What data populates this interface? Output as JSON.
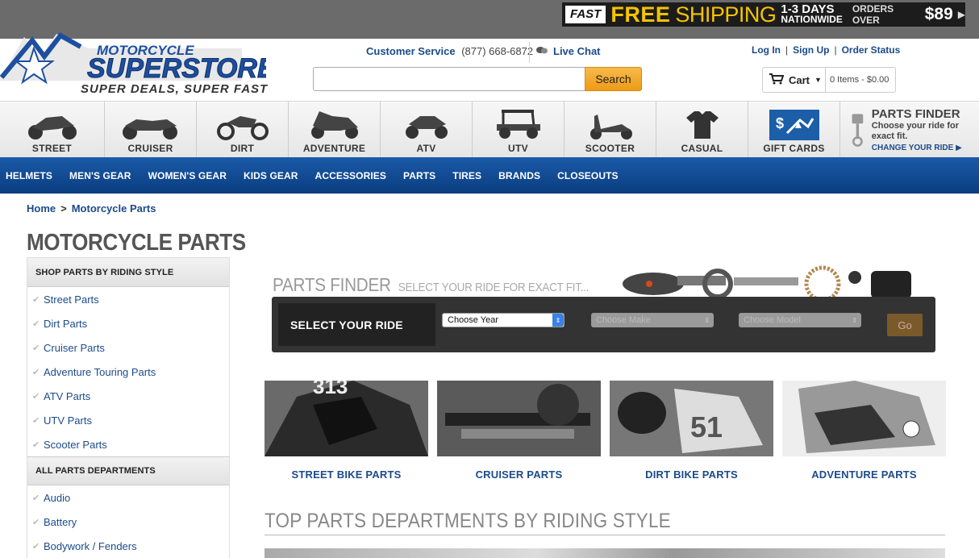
{
  "promo": {
    "fast": "FAST",
    "free": "FREE",
    "shipping": "SHIPPING",
    "days": "1-3 DAYS",
    "nationwide": "NATIONWIDE",
    "orders_over": "ORDERS OVER",
    "amount": "$89"
  },
  "header": {
    "logo_text": "MOTORCYCLE SUPERSTORE",
    "tagline": "SUPER DEALS, SUPER FAST",
    "customer_service_label": "Customer Service",
    "customer_service_phone": "(877) 668-6872",
    "live_chat": "Live Chat",
    "login": "Log In",
    "signup": "Sign Up",
    "order_status": "Order Status",
    "search_button": "Search",
    "cart_label": "Cart",
    "cart_items": "0 Items - $0.00"
  },
  "categories": [
    {
      "label": "STREET"
    },
    {
      "label": "CRUISER"
    },
    {
      "label": "DIRT"
    },
    {
      "label": "ADVENTURE"
    },
    {
      "label": "ATV"
    },
    {
      "label": "UTV"
    },
    {
      "label": "SCOOTER"
    },
    {
      "label": "CASUAL"
    },
    {
      "label": "GIFT CARDS"
    }
  ],
  "parts_finder_box": {
    "title": "PARTS FINDER",
    "subtitle": "Choose your ride for exact fit.",
    "link": "CHANGE YOUR RIDE ▶"
  },
  "nav": [
    "HELMETS",
    "MEN'S GEAR",
    "WOMEN'S GEAR",
    "KIDS GEAR",
    "ACCESSORIES",
    "PARTS",
    "TIRES",
    "BRANDS",
    "CLOSEOUTS"
  ],
  "breadcrumb": {
    "home": "Home",
    "current": "Motorcycle Parts"
  },
  "page_title": "MOTORCYCLE PARTS",
  "sidebar": {
    "section1_title": "SHOP PARTS BY RIDING STYLE",
    "section1_items": [
      "Street Parts",
      "Dirt Parts",
      "Cruiser Parts",
      "Adventure Touring Parts",
      "ATV Parts",
      "UTV Parts",
      "Scooter Parts"
    ],
    "section2_title": "ALL PARTS DEPARTMENTS",
    "section2_items": [
      "Audio",
      "Battery",
      "Bodywork / Fenders"
    ]
  },
  "finder": {
    "title": "PARTS FINDER",
    "subtitle": "SELECT YOUR RIDE FOR EXACT FIT...",
    "select_label": "SELECT YOUR RIDE",
    "year_placeholder": "Choose Year",
    "make_placeholder": "Choose Make",
    "model_placeholder": "Choose Model",
    "go": "Go"
  },
  "tiles": [
    {
      "label": "STREET BIKE PARTS"
    },
    {
      "label": "CRUISER PARTS"
    },
    {
      "label": "DIRT BIKE PARTS"
    },
    {
      "label": "ADVENTURE PARTS"
    }
  ],
  "top_departments_title": "TOP PARTS DEPARTMENTS BY RIDING STYLE",
  "colors": {
    "brand_blue": "#1c4b8a",
    "nav_blue": "#0b3d80",
    "promo_yellow": "#f4c400",
    "search_orange": "#ee9b16"
  }
}
